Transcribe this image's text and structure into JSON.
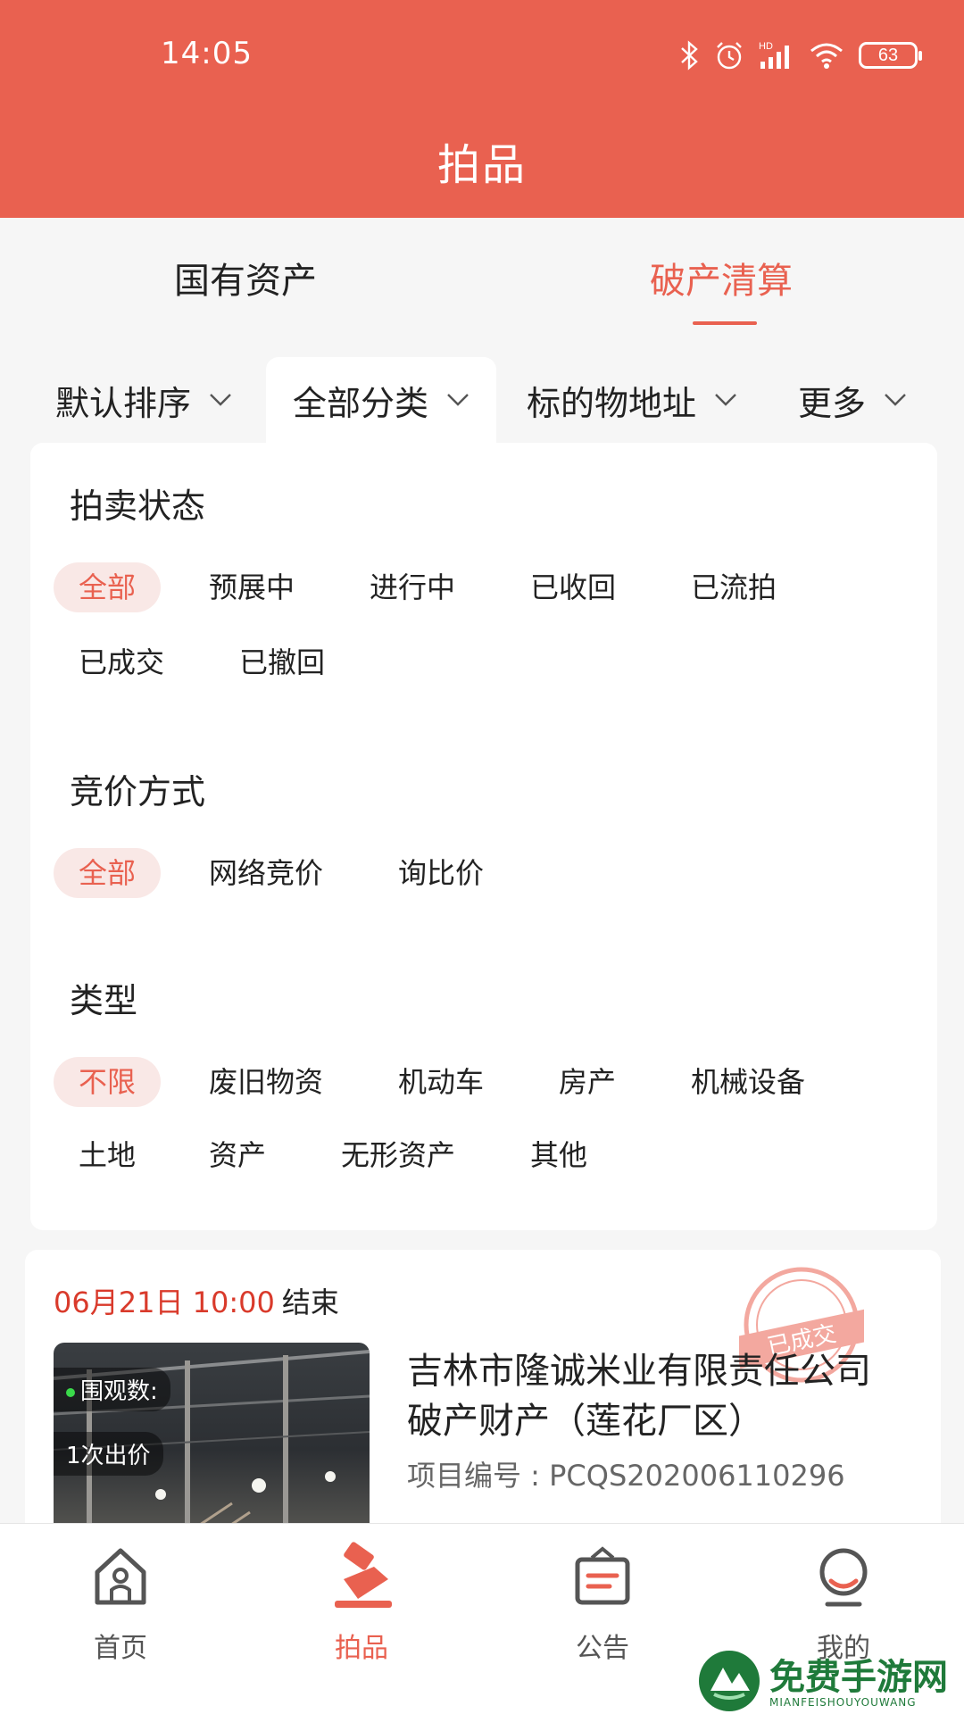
{
  "status_bar": {
    "time": "14:05",
    "battery": "63",
    "network": "HD",
    "icons": [
      "bluetooth-icon",
      "alarm-icon",
      "signal-icon",
      "wifi-icon",
      "battery-icon"
    ]
  },
  "header": {
    "title": "拍品"
  },
  "top_tabs": [
    {
      "label": "国有资产",
      "active": false
    },
    {
      "label": "破产清算",
      "active": true
    }
  ],
  "filters": [
    {
      "label": "默认排序",
      "active": false
    },
    {
      "label": "全部分类",
      "active": true
    },
    {
      "label": "标的物地址",
      "active": false
    },
    {
      "label": "更多",
      "active": false
    }
  ],
  "panel": {
    "auction_status": {
      "title": "拍卖状态",
      "options": [
        "全部",
        "预展中",
        "进行中",
        "已收回",
        "已流拍",
        "已成交",
        "已撤回"
      ],
      "selected": "全部"
    },
    "bidding_method": {
      "title": "竞价方式",
      "options": [
        "全部",
        "网络竞价",
        "询比价"
      ],
      "selected": "全部"
    },
    "type": {
      "title": "类型",
      "options": [
        "不限",
        "废旧物资",
        "机动车",
        "房产",
        "机械设备",
        "土地",
        "资产",
        "无形资产",
        "其他"
      ],
      "selected": "不限"
    }
  },
  "listing": {
    "date": "06月21日 10:00",
    "end_label": "结束",
    "stamp": "已成交",
    "views_label": "围观数:",
    "bids_label": "1次出价",
    "title_line1": "吉林市隆诚米业有限责任公司",
    "title_line2": "破产财产（莲花厂区）",
    "code": "项目编号 : PCQS202006110296"
  },
  "bottom_nav": [
    {
      "label": "首页",
      "icon": "home-icon",
      "active": false
    },
    {
      "label": "拍品",
      "icon": "auction-hammer-icon",
      "active": true
    },
    {
      "label": "公告",
      "icon": "announcement-icon",
      "active": false
    },
    {
      "label": "我的",
      "icon": "profile-icon",
      "active": false
    }
  ],
  "watermark": {
    "text": "免费手游网",
    "sub": "MIANFEISHOUYOUWANG"
  },
  "colors": {
    "accent": "#e96150",
    "accent_light": "#f9e8e6",
    "date_red": "#d93a2b"
  }
}
